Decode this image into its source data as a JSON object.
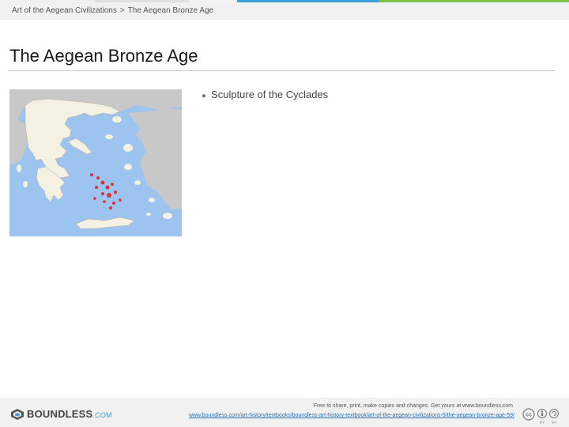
{
  "breadcrumb": {
    "parent": "Art of the Aegean Civilizations",
    "separator": ">",
    "current": "The Aegean Bronze Age"
  },
  "page_title": "The Aegean Bronze Age",
  "content": {
    "bullets": [
      "Sculpture of the Cyclades"
    ],
    "map_colors": {
      "sea": "#9dc3ef",
      "greece": "#f4f0e2",
      "neighbors": "#c8c8c8",
      "cyclades": "#d9323a"
    }
  },
  "footer": {
    "logo_main": "BOUNDLESS",
    "logo_suffix": ".COM",
    "note": "Free to share, print, make copies and changes. Get yours at www.boundless.com",
    "url": "www.boundless.com/art-history/textbooks/boundless-art-history-textbook/art-of-the-aegean-civilizations-5/the-aegean-bronze-age-59/",
    "license_icons": [
      "cc-icon",
      "by-icon",
      "sa-icon"
    ]
  },
  "accents": {
    "blue": "#3a9fd8",
    "green": "#7cc24a"
  }
}
